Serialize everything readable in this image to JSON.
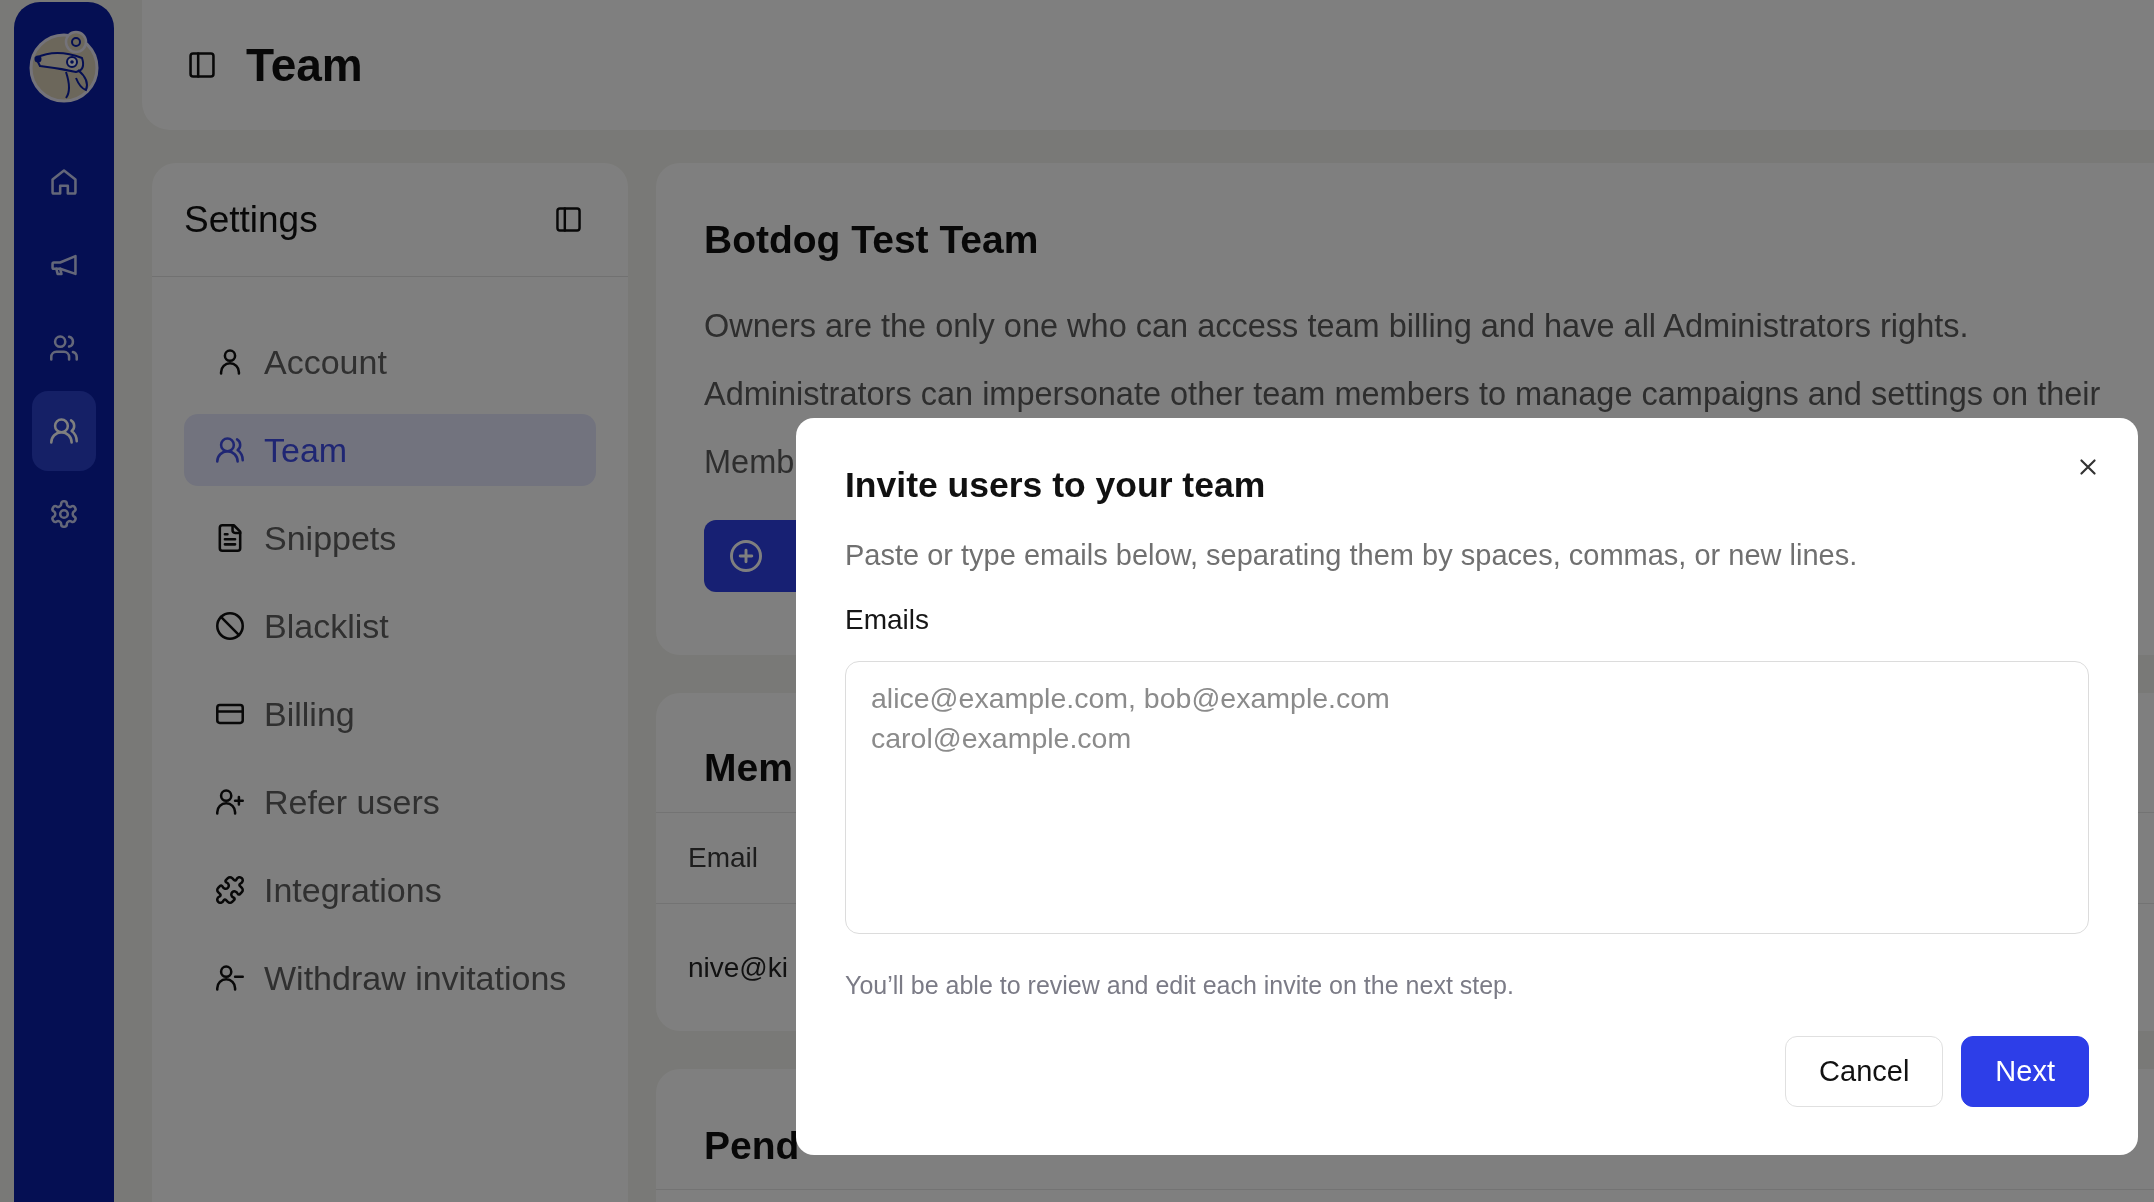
{
  "rail": {
    "items": [
      {
        "kind": "home",
        "selected": false
      },
      {
        "kind": "megaphone",
        "selected": false
      },
      {
        "kind": "contacts",
        "selected": false
      },
      {
        "kind": "team",
        "selected": true
      },
      {
        "kind": "settings",
        "selected": false
      }
    ]
  },
  "header": {
    "title": "Team"
  },
  "settings_menu": {
    "title": "Settings",
    "items": [
      {
        "kind": "account",
        "label": "Account",
        "selected": false
      },
      {
        "kind": "team",
        "label": "Team",
        "selected": true
      },
      {
        "kind": "snippets",
        "label": "Snippets",
        "selected": false
      },
      {
        "kind": "blacklist",
        "label": "Blacklist",
        "selected": false
      },
      {
        "kind": "billing",
        "label": "Billing",
        "selected": false
      },
      {
        "kind": "refer",
        "label": "Refer users",
        "selected": false
      },
      {
        "kind": "integrations",
        "label": "Integrations",
        "selected": false
      },
      {
        "kind": "withdraw",
        "label": "Withdraw invitations",
        "selected": false
      }
    ]
  },
  "team_card": {
    "title": "Botdog Test Team",
    "paragraphs": [
      "Owners are the only one who can access team billing and have all Administrators rights.",
      "Administrators can impersonate other team members to manage campaigns and settings on their",
      "Memb"
    ]
  },
  "members_card": {
    "title": "Mem",
    "columns": [
      "Email"
    ],
    "rows": [
      [
        "nive@ki"
      ]
    ]
  },
  "pending_card": {
    "title": "Pend"
  },
  "modal": {
    "title": "Invite users to your team",
    "description": "Paste or type emails below, separating them by spaces, commas, or new lines.",
    "field_label": "Emails",
    "placeholder": "alice@example.com, bob@example.com\ncarol@example.com",
    "hint": "You’ll be able to review and edit each invite on the next step.",
    "buttons": [
      {
        "kind": "secondary",
        "label": "Cancel"
      },
      {
        "kind": "primary",
        "label": "Next"
      }
    ]
  }
}
